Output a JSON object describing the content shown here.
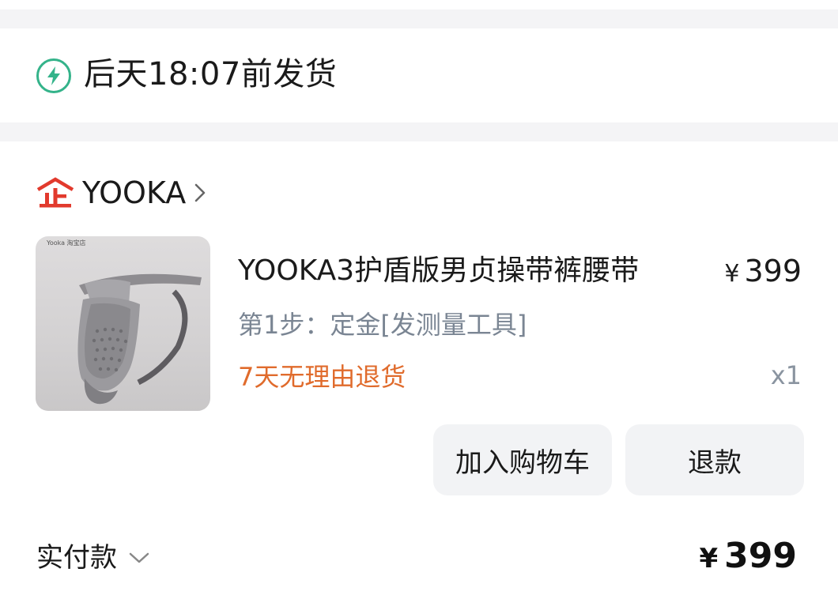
{
  "shipping": {
    "icon": "lightning-icon",
    "text": "后天18:07前发货",
    "accent_color": "#34b38a"
  },
  "shop": {
    "icon": "enterprise-shop-icon",
    "name": "YOOKA",
    "brand_color": "#e23a2d"
  },
  "item": {
    "thumbnail_watermark": "Yooka 淘宝店",
    "title": "YOOKA3护盾版男贞操带裤腰带",
    "currency": "¥",
    "price": "399",
    "spec": "第1步：定金[发测量工具]",
    "promise": "7天无理由退货",
    "promise_color": "#e06b2c",
    "quantity": "x1"
  },
  "actions": {
    "add_to_cart": "加入购物车",
    "refund": "退款"
  },
  "payment": {
    "label": "实付款",
    "currency": "¥",
    "amount": "399"
  }
}
